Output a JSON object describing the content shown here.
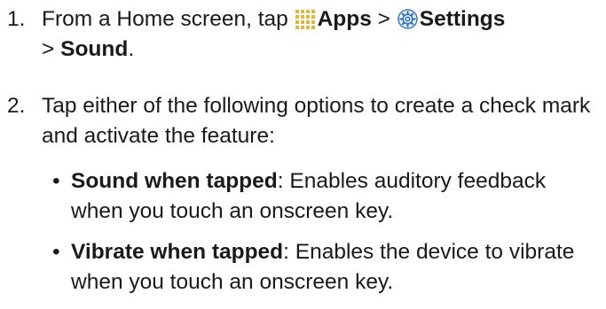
{
  "steps": [
    {
      "number": "1.",
      "pre": "From a Home screen, tap ",
      "apps_label": "Apps",
      "sep": " > ",
      "settings_label": "Settings",
      "line2_prefix": "> ",
      "sound_label": "Sound",
      "end": "."
    },
    {
      "number": "2.",
      "text": "Tap either of the following options to create a check mark and activate the feature:"
    }
  ],
  "options": [
    {
      "bullet": "•",
      "name": "Sound when tapped",
      "desc": ": Enables auditory feedback when you touch an onscreen key."
    },
    {
      "bullet": "•",
      "name": "Vibrate when tapped",
      "desc": ": Enables the device to vibrate when you touch an onscreen key."
    }
  ],
  "icons": {
    "apps": "apps-grid-icon",
    "settings": "settings-gear-icon"
  },
  "colors": {
    "text": "#1a1a1a",
    "apps_icon": "#e0b53a",
    "settings_icon": "#2f6fb5"
  }
}
